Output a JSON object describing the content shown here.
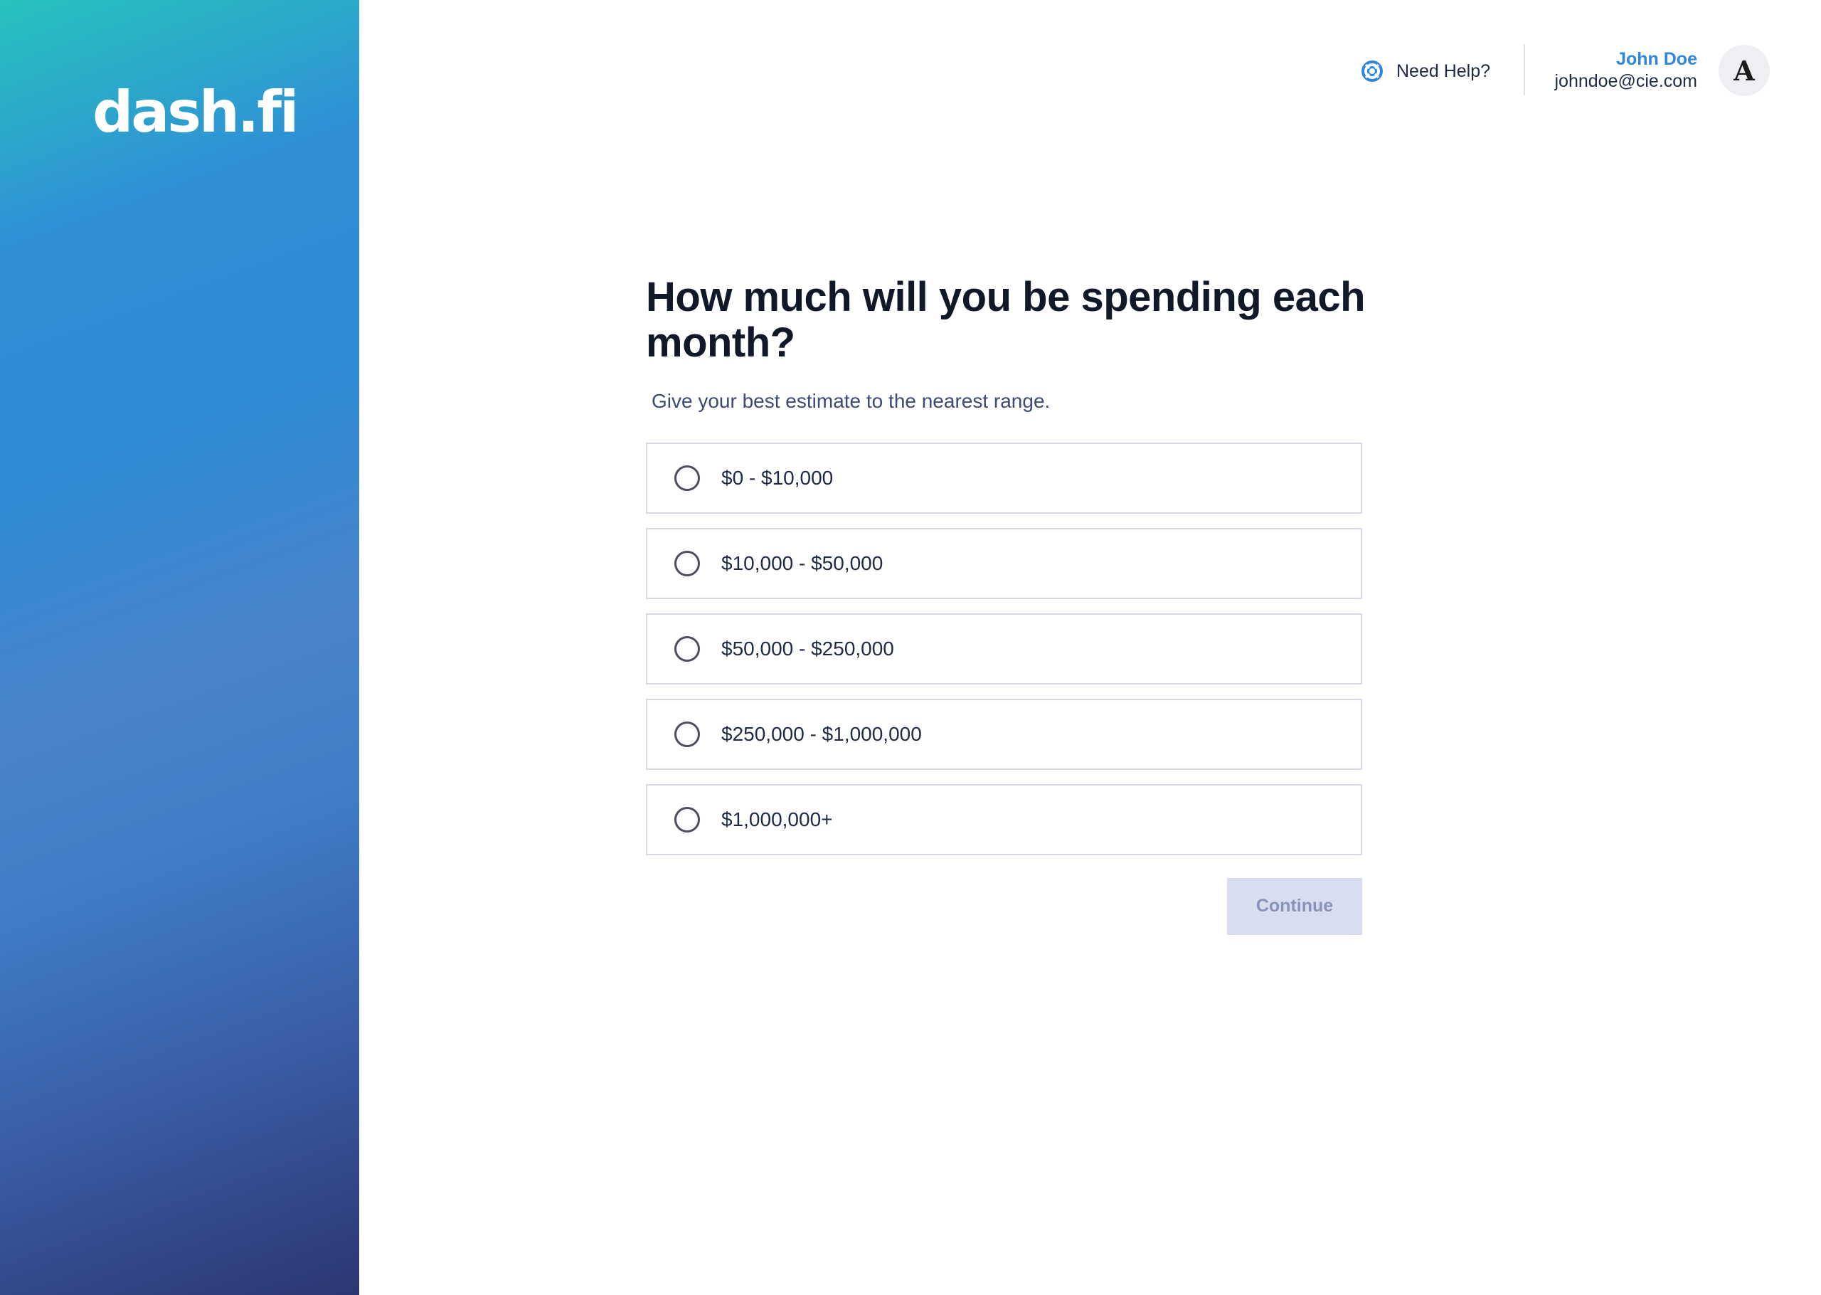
{
  "brand": {
    "logo_text": "dash.fi"
  },
  "header": {
    "help_label": "Need Help?",
    "help_icon": "lifebuoy-icon",
    "user_name": "John Doe",
    "user_email": "johndoe@cie.com",
    "avatar_letter": "A"
  },
  "main": {
    "title": "How much will you be spending each month?",
    "subtitle": "Give your best estimate to the nearest range.",
    "options": [
      {
        "label": "$0 - $10,000",
        "selected": false
      },
      {
        "label": "$10,000 - $50,000",
        "selected": false
      },
      {
        "label": "$50,000 - $250,000",
        "selected": false
      },
      {
        "label": "$250,000 - $1,000,000",
        "selected": false
      },
      {
        "label": "$1,000,000+",
        "selected": false
      }
    ],
    "continue_label": "Continue",
    "continue_enabled": false
  },
  "colors": {
    "accent": "#2f86e0",
    "button_disabled_bg": "#d8deef",
    "button_disabled_text": "#8793bb"
  }
}
